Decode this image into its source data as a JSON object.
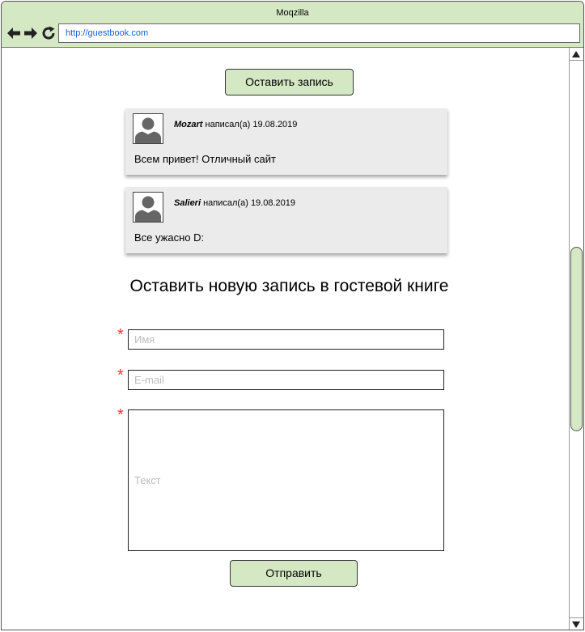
{
  "window": {
    "title": "Moqzilla",
    "url": "http://guestbook.com"
  },
  "toolbar": {
    "back_icon": "arrow-left-icon",
    "forward_icon": "arrow-right-icon",
    "reload_icon": "reload-icon"
  },
  "main": {
    "add_entry_label": "Оставить запись",
    "entries": [
      {
        "author": "Mozart",
        "wrote": "написал(а)",
        "date": "19.08.2019",
        "text": "Всем привет! Отличный сайт"
      },
      {
        "author": "Salieri",
        "wrote": "написал(а)",
        "date": "19.08.2019",
        "text": "Все ужасно D:"
      }
    ],
    "form": {
      "title": "Оставить новую запись в гостевой книге",
      "required_mark": "*",
      "name_placeholder": "Имя",
      "email_placeholder": "E-mail",
      "text_placeholder": "Текст",
      "submit_label": "Отправить"
    }
  },
  "colors": {
    "accent": "#d5e8c4",
    "required": "#e53b2c",
    "url_text": "#1a5fd0",
    "card_bg": "#ebebeb"
  }
}
